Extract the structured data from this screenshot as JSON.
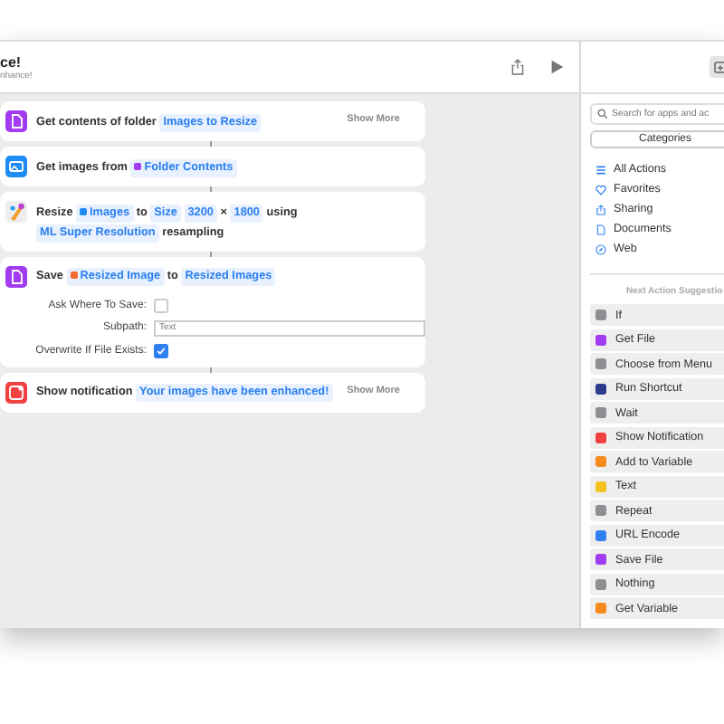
{
  "header": {
    "title": "ce!",
    "subtitle": "nhance!"
  },
  "actions": [
    {
      "kind": "document",
      "color": "#a23cf0",
      "parts": [
        {
          "kind": "text",
          "text": "Get contents of folder"
        },
        {
          "kind": "token",
          "text": "Images to Resize"
        }
      ],
      "show_more": "Show More"
    },
    {
      "kind": "photos",
      "color": "#1f8cf5",
      "parts": [
        {
          "kind": "text",
          "text": "Get images from"
        },
        {
          "kind": "variable",
          "text": "Folder Contents",
          "color": "#a23cf0"
        }
      ]
    },
    {
      "kind": "brush",
      "color": "#f0a030",
      "parts": [
        {
          "kind": "text",
          "text": "Resize"
        },
        {
          "kind": "variable",
          "text": "Images",
          "color": "#1f8cf5"
        },
        {
          "kind": "text",
          "text": "to"
        },
        {
          "kind": "token",
          "text": "Size"
        },
        {
          "kind": "token",
          "text": "3200"
        },
        {
          "kind": "text",
          "text": "×"
        },
        {
          "kind": "token",
          "text": "1800"
        },
        {
          "kind": "text",
          "text": "using"
        },
        {
          "kind": "token",
          "text": "ML Super Resolution"
        },
        {
          "kind": "text",
          "text": "resampling"
        }
      ]
    },
    {
      "kind": "document",
      "color": "#a23cf0",
      "parts": [
        {
          "kind": "text",
          "text": "Save"
        },
        {
          "kind": "variable",
          "text": "Resized Image",
          "color": "#f06a30"
        },
        {
          "kind": "text",
          "text": "to"
        },
        {
          "kind": "token",
          "text": "Resized Images"
        }
      ],
      "fields": [
        {
          "kind": "checkbox",
          "label": "Ask Where To Save:",
          "checked": false
        },
        {
          "kind": "text",
          "label": "Subpath:",
          "placeholder": "Text"
        },
        {
          "kind": "checkbox",
          "label": "Overwrite If File Exists:",
          "checked": true
        }
      ]
    },
    {
      "kind": "notification",
      "color": "#f04040",
      "parts": [
        {
          "kind": "text",
          "text": "Show notification"
        },
        {
          "kind": "token",
          "text": "Your images have been enhanced!"
        }
      ],
      "show_more": "Show More"
    }
  ],
  "sidebar": {
    "search": {
      "placeholder": "Search for apps and ac"
    },
    "categories_button": "Categories",
    "categories": [
      {
        "kind": "list",
        "label": "All Actions"
      },
      {
        "kind": "heart",
        "label": "Favorites"
      },
      {
        "kind": "share",
        "label": "Sharing"
      },
      {
        "kind": "document",
        "label": "Documents"
      },
      {
        "kind": "compass",
        "label": "Web"
      }
    ],
    "suggestions_heading": "Next Action Suggestio",
    "suggestions": [
      {
        "name": "If",
        "color": "#8e8e93"
      },
      {
        "name": "Get File",
        "color": "#a23cf0"
      },
      {
        "name": "Choose from Menu",
        "color": "#8e8e93"
      },
      {
        "name": "Run Shortcut",
        "color": "#2c3a8c"
      },
      {
        "name": "Wait",
        "color": "#8e8e93"
      },
      {
        "name": "Show Notification",
        "color": "#f04040"
      },
      {
        "name": "Add to Variable",
        "color": "#f58a1f"
      },
      {
        "name": "Text",
        "color": "#f5c21f"
      },
      {
        "name": "Repeat",
        "color": "#8e8e93"
      },
      {
        "name": "URL Encode",
        "color": "#2f80f0"
      },
      {
        "name": "Save File",
        "color": "#a23cf0"
      },
      {
        "name": "Nothing",
        "color": "#8e8e93"
      },
      {
        "name": "Get Variable",
        "color": "#f58a1f"
      }
    ]
  }
}
